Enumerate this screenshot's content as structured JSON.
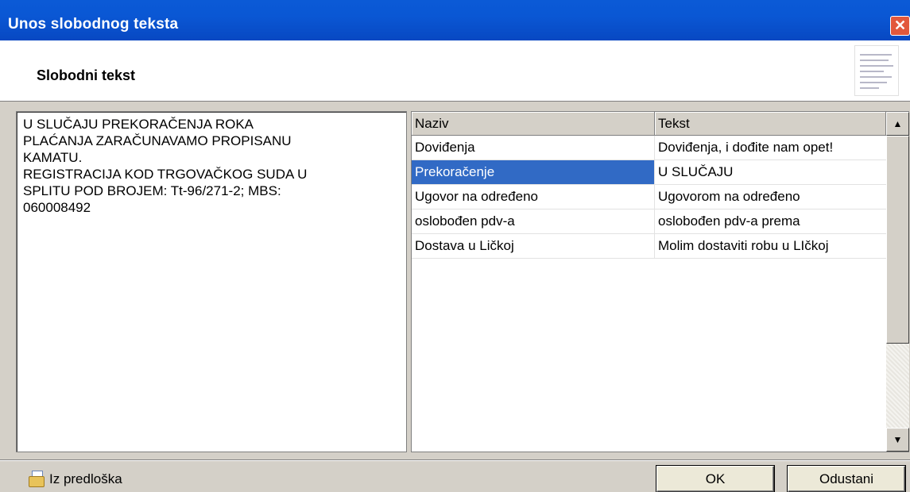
{
  "window": {
    "title": "Unos slobodnog teksta",
    "close_glyph": "✕"
  },
  "header": {
    "title": "Slobodni tekst",
    "icon": "list-document-icon"
  },
  "editor": {
    "text": "U SLUČAJU PREKORAČENJA ROKA\nPLAĆANJA ZARAČUNAVAMO PROPISANU\nKAMATU.\nREGISTRACIJA KOD TRGOVAČKOG SUDA U\nSPLITU POD BROJEM: Tt-96/271-2; MBS:\n060008492"
  },
  "grid": {
    "columns": [
      "Naziv",
      "Tekst"
    ],
    "rows": [
      {
        "naziv": "Doviđenja",
        "tekst": "Doviđenja, i dođite nam opet!"
      },
      {
        "naziv": "Prekoračenje",
        "tekst": "U SLUČAJU"
      },
      {
        "naziv": "Ugovor na određeno",
        "tekst": "Ugovorom na određeno"
      },
      {
        "naziv": "oslobođen pdv-a",
        "tekst": "oslobođen pdv-a prema"
      },
      {
        "naziv": "Dostava u Ličkoj",
        "tekst": "Molim dostaviti robu u LIčkoj"
      }
    ],
    "selected_row": 1,
    "scroll_up_glyph": "▲",
    "scroll_down_glyph": "▼"
  },
  "footer": {
    "template_label": "Iz predloška",
    "ok_label": "OK",
    "cancel_label": "Odustani"
  },
  "colors": {
    "titlebar": "#0a57d4",
    "selection": "#316ac5"
  }
}
